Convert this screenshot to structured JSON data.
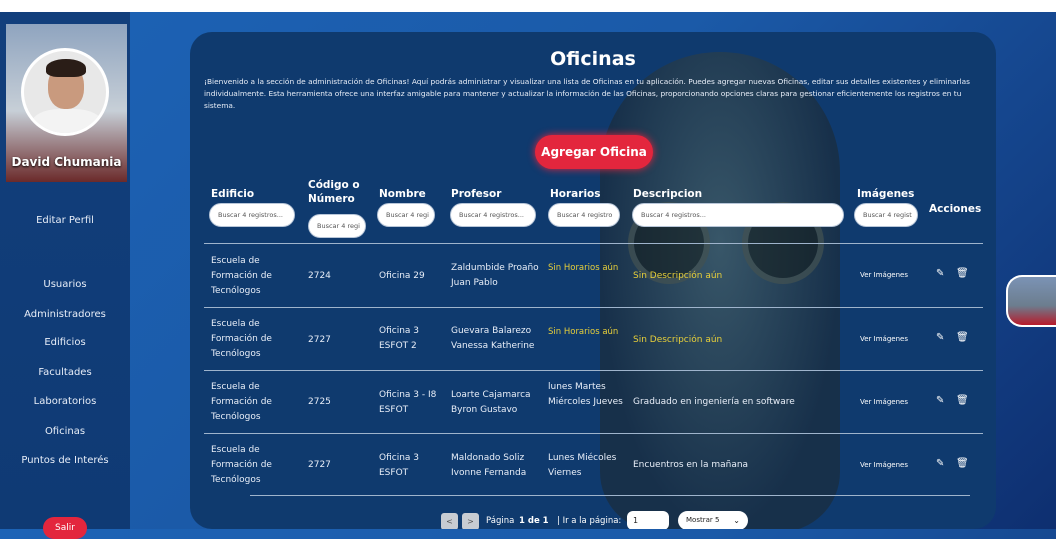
{
  "user": {
    "name": "David Chumania"
  },
  "sidebar": {
    "edit_profile": "Editar Perfil",
    "items": [
      "Usuarios",
      "Administradores",
      "Edificios",
      "Facultades",
      "Laboratorios",
      "Oficinas",
      "Puntos de Interés"
    ],
    "logout": "Salir"
  },
  "page": {
    "title": "Oficinas",
    "intro": "¡Bienvenido a la sección de administración de Oficinas! Aquí podrás administrar y visualizar una lista de Oficinas en tu aplicación. Puedes agregar nuevas Oficinas, editar sus detalles existentes y eliminarlas individualmente. Esta herramienta ofrece una interfaz amigable para mantener y actualizar la información de las Oficinas, proporcionando opciones claras para gestionar eficientemente los registros en tu sistema.",
    "add_button": "Agregar Oficina"
  },
  "table": {
    "headers": {
      "edificio": "Edificio",
      "codigo": "Código o Número",
      "nombre": "Nombre",
      "profesor": "Profesor",
      "horarios": "Horarios",
      "descripcion": "Descripcion",
      "imagenes": "Imágenes",
      "acciones": "Acciones"
    },
    "filters": {
      "edificio": "Buscar 4 registros...",
      "codigo": "Buscar 4 regi",
      "nombre": "Buscar 4 regi",
      "profesor": "Buscar 4 registros...",
      "horarios": "Buscar 4 registro",
      "descripcion": "Buscar 4 registros...",
      "imagenes": "Buscar 4 regist"
    },
    "rows": [
      {
        "edificio": "Escuela de Formación de Tecnólogos",
        "codigo": "2724",
        "nombre": "Oficina 29",
        "profesor": "Zaldumbide Proaño Juan Pablo",
        "horarios": "Sin Horarios aún",
        "descripcion": "Sin Descripción aún",
        "imagenes": "Ver Imágenes"
      },
      {
        "edificio": "Escuela de Formación de Tecnólogos",
        "codigo": "2727",
        "nombre": "Oficina 3 ESFOT 2",
        "profesor": "Guevara Balarezo Vanessa Katherine",
        "horarios": "Sin Horarios aún",
        "descripcion": "Sin Descripción aún",
        "imagenes": "Ver Imágenes"
      },
      {
        "edificio": "Escuela de Formación de Tecnólogos",
        "codigo": "2725",
        "nombre": "Oficina 3 - I8 ESFOT",
        "profesor": "Loarte Cajamarca Byron Gustavo",
        "horarios": "lunes Martes Miércoles Jueves",
        "descripcion": "Graduado en ingeniería en software",
        "imagenes": "Ver Imágenes"
      },
      {
        "edificio": "Escuela de Formación de Tecnólogos",
        "codigo": "2727",
        "nombre": "Oficina 3 ESFOT",
        "profesor": "Maldonado Soliz Ivonne Fernanda",
        "horarios": "Lunes Miécoles Viernes",
        "descripcion": "Encuentros en la mañana",
        "imagenes": "Ver Imágenes"
      }
    ]
  },
  "pagination": {
    "prev": "<",
    "next": ">",
    "page_label": "Página",
    "page_value": "1 de 1",
    "goto_label": "| Ir a la página:",
    "goto_value": "1",
    "show_label": "Mostrar 5"
  },
  "icons": {
    "edit": "edit-icon",
    "delete": "trash-icon"
  }
}
